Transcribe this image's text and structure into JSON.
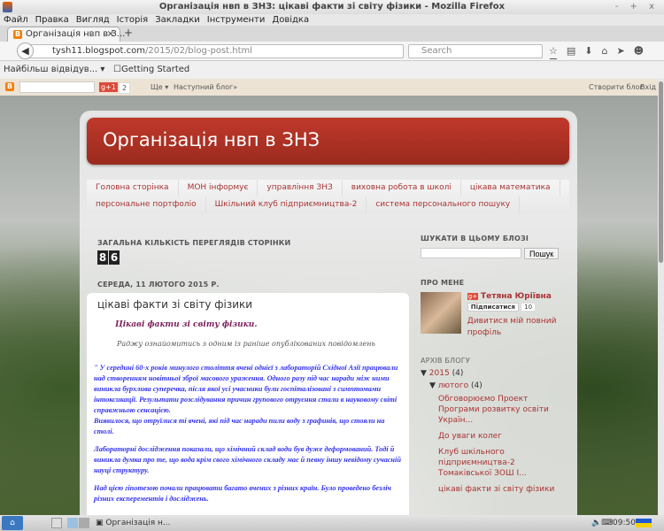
{
  "window": {
    "title": "Організація нвп в ЗНЗ: цікаві факти зі світу фізики - Mozilla Firefox",
    "controls": "- + x"
  },
  "menu": [
    "Файл",
    "Правка",
    "Вигляд",
    "Історія",
    "Закладки",
    "Інструменти",
    "Довідка"
  ],
  "tab": {
    "label": "Організація нвп в З...",
    "close": "×",
    "new": "+"
  },
  "url": {
    "host": "tysh11.blogspot.com",
    "path": "/2015/02/blog-post.html"
  },
  "search_placeholder": "Search",
  "bookmarks": {
    "most_visited": "Найбільш відвідув... ▾",
    "getting_started": "Getting Started"
  },
  "bloggerbar": {
    "gplus": "g+1",
    "count": "2",
    "more": "Ще ▾",
    "next": "Наступний блог»",
    "create": "Створити блог",
    "login": "Вхід"
  },
  "blog": {
    "title": "Організація нвп в ЗНЗ",
    "tabs_row1": [
      "Головна сторінка",
      "МОН інформує",
      "управління ЗНЗ",
      "виховна робота в школі",
      "цікава математика"
    ],
    "tabs_row2": [
      "персональне портфоліо",
      "Шкільний клуб підприємництва-2",
      "система персонального пошуку"
    ],
    "views_heading": "ЗАГАЛЬНА КІЛЬКІСТЬ ПЕРЕГЛЯДІВ СТОРІНКИ",
    "views_digits": [
      "8",
      "6"
    ],
    "date": "СЕРЕДА, 11 ЛЮТОГО 2015 Р.",
    "post": {
      "title": "цікаві факти зі світу фізики",
      "subtitle": "Цікаві факти зі світу фізики.",
      "intro": "Раджу ознайомитись з одним із раніше опублікованих повідомлень",
      "paragraphs": [
        "\" У середині 60-х років минулого століття вчені однієї з лабораторій Східної Азії працювали над створенням новітньої зброї масового ураження. Одного разу під час наради між ними виникла бурхлива суперечка, після якої усі учасники були госпіталізовані з симптомами інтоксикації. Результати розслідування причин групового отруєння стали в науковому світі справжньою сенсацією.",
        "Виявилося, що отруїлися ті вчені, які під час наради пили воду з графинів, що стояли на столі.",
        "Лабораторні дослідження показали, що хімічний склад води був дуже деформований. Тоді й виникла думка про те, що вода крім свого хімічного складу має й певну іншу невідому сучасній науці структуру.",
        "Над цією гіпотезою почали працювати багато вчених з різних країн. Було проведено безліч різних експерементів і досліджень."
      ]
    }
  },
  "sidebar": {
    "search_heading": "ШУКАТИ В ЦЬОМУ БЛОЗІ",
    "search_button": "Пошук",
    "about_heading": "ПРО МЕНЕ",
    "name": "Тетяна Юріївна",
    "follow": "Підписатися",
    "followers": "10",
    "profile": "Дивитися мій повний профіль",
    "archive_heading": "АРХІВ БЛОГУ",
    "year": "2015",
    "year_count": "(4)",
    "month": "лютого",
    "month_count": "(4)",
    "posts": [
      "Обговорюємо Проект Програми розвитку освіти Україн...",
      "До уваги колег",
      "Клуб шкільного підприємництва-2 Томаківської ЗОШ І...",
      "цікаві факти зі світу фізики"
    ]
  },
  "taskbar": {
    "window": "Організація н...",
    "time": "09:50"
  }
}
